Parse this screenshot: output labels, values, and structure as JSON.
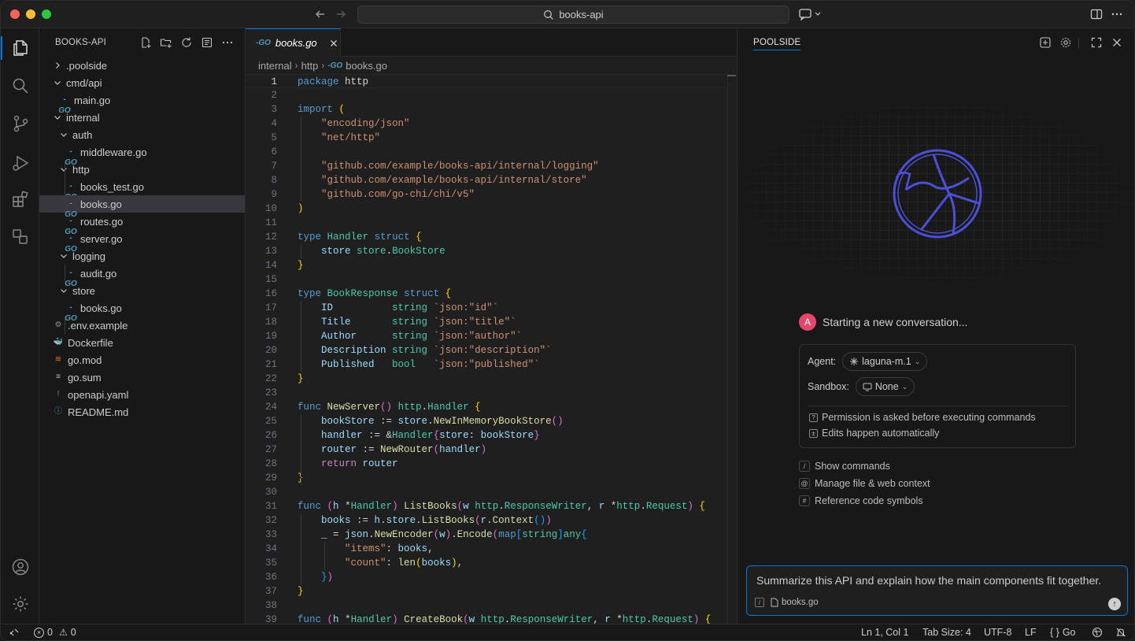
{
  "titlebar": {
    "search_text": "books-api"
  },
  "sidebar": {
    "title": "BOOKS-API",
    "tree": [
      {
        "label": ".poolside",
        "depth": 0,
        "kind": "folder-closed"
      },
      {
        "label": "cmd/api",
        "depth": 0,
        "kind": "folder-open"
      },
      {
        "label": "main.go",
        "depth": 1,
        "kind": "go"
      },
      {
        "label": "internal",
        "depth": 0,
        "kind": "folder-open"
      },
      {
        "label": "auth",
        "depth": 1,
        "kind": "folder-open"
      },
      {
        "label": "middleware.go",
        "depth": 2,
        "kind": "go"
      },
      {
        "label": "http",
        "depth": 1,
        "kind": "folder-open"
      },
      {
        "label": "books_test.go",
        "depth": 2,
        "kind": "go"
      },
      {
        "label": "books.go",
        "depth": 2,
        "kind": "go",
        "selected": true
      },
      {
        "label": "routes.go",
        "depth": 2,
        "kind": "go"
      },
      {
        "label": "server.go",
        "depth": 2,
        "kind": "go"
      },
      {
        "label": "logging",
        "depth": 1,
        "kind": "folder-open"
      },
      {
        "label": "audit.go",
        "depth": 2,
        "kind": "go"
      },
      {
        "label": "store",
        "depth": 1,
        "kind": "folder-open"
      },
      {
        "label": "books.go",
        "depth": 2,
        "kind": "go"
      },
      {
        "label": ".env.example",
        "depth": 0,
        "kind": "gear"
      },
      {
        "label": "Dockerfile",
        "depth": 0,
        "kind": "docker"
      },
      {
        "label": "go.mod",
        "depth": 0,
        "kind": "rss"
      },
      {
        "label": "go.sum",
        "depth": 0,
        "kind": "lines"
      },
      {
        "label": "openapi.yaml",
        "depth": 0,
        "kind": "yaml"
      },
      {
        "label": "README.md",
        "depth": 0,
        "kind": "info"
      }
    ]
  },
  "editor": {
    "tab_label": "books.go",
    "breadcrumb": [
      "internal",
      "http",
      "books.go"
    ],
    "current_line": 1,
    "lines": [
      [
        [
          "kw",
          "package"
        ],
        [
          "pl",
          " http"
        ]
      ],
      [],
      [
        [
          "kw",
          "import"
        ],
        [
          "pl",
          " "
        ],
        [
          "br",
          "("
        ]
      ],
      [
        [
          "pl",
          "    "
        ],
        [
          "str",
          "\"encoding/json\""
        ]
      ],
      [
        [
          "pl",
          "    "
        ],
        [
          "str",
          "\"net/http\""
        ]
      ],
      [],
      [
        [
          "pl",
          "    "
        ],
        [
          "str",
          "\"github.com/example/books-api/internal/logging\""
        ]
      ],
      [
        [
          "pl",
          "    "
        ],
        [
          "str",
          "\"github.com/example/books-api/internal/store\""
        ]
      ],
      [
        [
          "pl",
          "    "
        ],
        [
          "str",
          "\"github.com/go-chi/chi/v5\""
        ]
      ],
      [
        [
          "br",
          ")"
        ]
      ],
      [],
      [
        [
          "kw",
          "type"
        ],
        [
          "pl",
          " "
        ],
        [
          "ty",
          "Handler"
        ],
        [
          "pl",
          " "
        ],
        [
          "kw",
          "struct"
        ],
        [
          "pl",
          " "
        ],
        [
          "br",
          "{"
        ]
      ],
      [
        [
          "pl",
          "    "
        ],
        [
          "var",
          "store"
        ],
        [
          "pl",
          " "
        ],
        [
          "ty",
          "store"
        ],
        [
          "pl",
          "."
        ],
        [
          "ty",
          "BookStore"
        ]
      ],
      [
        [
          "br",
          "}"
        ]
      ],
      [],
      [
        [
          "kw",
          "type"
        ],
        [
          "pl",
          " "
        ],
        [
          "ty",
          "BookResponse"
        ],
        [
          "pl",
          " "
        ],
        [
          "kw",
          "struct"
        ],
        [
          "pl",
          " "
        ],
        [
          "br",
          "{"
        ]
      ],
      [
        [
          "pl",
          "    "
        ],
        [
          "var",
          "ID"
        ],
        [
          "pl",
          "          "
        ],
        [
          "ty",
          "string"
        ],
        [
          "pl",
          " "
        ],
        [
          "str",
          "`json:\"id\"`"
        ]
      ],
      [
        [
          "pl",
          "    "
        ],
        [
          "var",
          "Title"
        ],
        [
          "pl",
          "       "
        ],
        [
          "ty",
          "string"
        ],
        [
          "pl",
          " "
        ],
        [
          "str",
          "`json:\"title\"`"
        ]
      ],
      [
        [
          "pl",
          "    "
        ],
        [
          "var",
          "Author"
        ],
        [
          "pl",
          "      "
        ],
        [
          "ty",
          "string"
        ],
        [
          "pl",
          " "
        ],
        [
          "str",
          "`json:\"author\"`"
        ]
      ],
      [
        [
          "pl",
          "    "
        ],
        [
          "var",
          "Description"
        ],
        [
          "pl",
          " "
        ],
        [
          "ty",
          "string"
        ],
        [
          "pl",
          " "
        ],
        [
          "str",
          "`json:\"description\"`"
        ]
      ],
      [
        [
          "pl",
          "    "
        ],
        [
          "var",
          "Published"
        ],
        [
          "pl",
          "   "
        ],
        [
          "ty",
          "bool"
        ],
        [
          "pl",
          "   "
        ],
        [
          "str",
          "`json:\"published\"`"
        ]
      ],
      [
        [
          "br",
          "}"
        ]
      ],
      [],
      [
        [
          "kw",
          "func"
        ],
        [
          "pl",
          " "
        ],
        [
          "fn",
          "NewServer"
        ],
        [
          "br2",
          "()"
        ],
        [
          "pl",
          " "
        ],
        [
          "ty",
          "http"
        ],
        [
          "pl",
          "."
        ],
        [
          "ty",
          "Handler"
        ],
        [
          "pl",
          " "
        ],
        [
          "br",
          "{"
        ]
      ],
      [
        [
          "pl",
          "    "
        ],
        [
          "var",
          "bookStore"
        ],
        [
          "pl",
          " := "
        ],
        [
          "var",
          "store"
        ],
        [
          "pl",
          "."
        ],
        [
          "fn",
          "NewInMemoryBookStore"
        ],
        [
          "br2",
          "()"
        ]
      ],
      [
        [
          "pl",
          "    "
        ],
        [
          "var",
          "handler"
        ],
        [
          "pl",
          " := &"
        ],
        [
          "ty",
          "Handler"
        ],
        [
          "br2",
          "{"
        ],
        [
          "var",
          "store"
        ],
        [
          "pl",
          ": "
        ],
        [
          "var",
          "bookStore"
        ],
        [
          "br2",
          "}"
        ]
      ],
      [
        [
          "pl",
          "    "
        ],
        [
          "var",
          "router"
        ],
        [
          "pl",
          " := "
        ],
        [
          "fn",
          "NewRouter"
        ],
        [
          "br2",
          "("
        ],
        [
          "var",
          "handler"
        ],
        [
          "br2",
          ")"
        ]
      ],
      [
        [
          "pl",
          "    "
        ],
        [
          "kw2",
          "return"
        ],
        [
          "pl",
          " "
        ],
        [
          "var",
          "router"
        ]
      ],
      [
        [
          "br",
          "}"
        ]
      ],
      [],
      [
        [
          "kw",
          "func"
        ],
        [
          "pl",
          " "
        ],
        [
          "br2",
          "("
        ],
        [
          "var",
          "h"
        ],
        [
          "pl",
          " *"
        ],
        [
          "ty",
          "Handler"
        ],
        [
          "br2",
          ")"
        ],
        [
          "pl",
          " "
        ],
        [
          "fn",
          "ListBooks"
        ],
        [
          "br2",
          "("
        ],
        [
          "var",
          "w"
        ],
        [
          "pl",
          " "
        ],
        [
          "ty",
          "http"
        ],
        [
          "pl",
          "."
        ],
        [
          "ty",
          "ResponseWriter"
        ],
        [
          "pl",
          ", "
        ],
        [
          "var",
          "r"
        ],
        [
          "pl",
          " *"
        ],
        [
          "ty",
          "http"
        ],
        [
          "pl",
          "."
        ],
        [
          "ty",
          "Request"
        ],
        [
          "br2",
          ")"
        ],
        [
          "pl",
          " "
        ],
        [
          "br",
          "{"
        ]
      ],
      [
        [
          "pl",
          "    "
        ],
        [
          "var",
          "books"
        ],
        [
          "pl",
          " := "
        ],
        [
          "var",
          "h"
        ],
        [
          "pl",
          "."
        ],
        [
          "var",
          "store"
        ],
        [
          "pl",
          "."
        ],
        [
          "fn",
          "ListBooks"
        ],
        [
          "br2",
          "("
        ],
        [
          "var",
          "r"
        ],
        [
          "pl",
          "."
        ],
        [
          "fn",
          "Context"
        ],
        [
          "br3",
          "()"
        ],
        [
          "br2",
          ")"
        ]
      ],
      [
        [
          "pl",
          "    "
        ],
        [
          "var",
          "_"
        ],
        [
          "pl",
          " = "
        ],
        [
          "var",
          "json"
        ],
        [
          "pl",
          "."
        ],
        [
          "fn",
          "NewEncoder"
        ],
        [
          "br2",
          "("
        ],
        [
          "var",
          "w"
        ],
        [
          "br2",
          ")"
        ],
        [
          "pl",
          "."
        ],
        [
          "fn",
          "Encode"
        ],
        [
          "br2",
          "("
        ],
        [
          "kw",
          "map"
        ],
        [
          "br3",
          "["
        ],
        [
          "ty",
          "string"
        ],
        [
          "br3",
          "]"
        ],
        [
          "ty",
          "any"
        ],
        [
          "br3",
          "{"
        ]
      ],
      [
        [
          "pl",
          "        "
        ],
        [
          "str",
          "\"items\""
        ],
        [
          "pl",
          ": "
        ],
        [
          "var",
          "books"
        ],
        [
          "pl",
          ","
        ]
      ],
      [
        [
          "pl",
          "        "
        ],
        [
          "str",
          "\"count\""
        ],
        [
          "pl",
          ": "
        ],
        [
          "fn",
          "len"
        ],
        [
          "br",
          "("
        ],
        [
          "var",
          "books"
        ],
        [
          "br",
          ")"
        ],
        [
          "pl",
          ","
        ]
      ],
      [
        [
          "pl",
          "    "
        ],
        [
          "br3",
          "}"
        ],
        [
          "br2",
          ")"
        ]
      ],
      [
        [
          "br",
          "}"
        ]
      ],
      [],
      [
        [
          "kw",
          "func"
        ],
        [
          "pl",
          " "
        ],
        [
          "br2",
          "("
        ],
        [
          "var",
          "h"
        ],
        [
          "pl",
          " *"
        ],
        [
          "ty",
          "Handler"
        ],
        [
          "br2",
          ")"
        ],
        [
          "pl",
          " "
        ],
        [
          "fn",
          "CreateBook"
        ],
        [
          "br2",
          "("
        ],
        [
          "var",
          "w"
        ],
        [
          "pl",
          " "
        ],
        [
          "ty",
          "http"
        ],
        [
          "pl",
          "."
        ],
        [
          "ty",
          "ResponseWriter"
        ],
        [
          "pl",
          ", "
        ],
        [
          "var",
          "r"
        ],
        [
          "pl",
          " *"
        ],
        [
          "ty",
          "http"
        ],
        [
          "pl",
          "."
        ],
        [
          "ty",
          "Request"
        ],
        [
          "br2",
          ")"
        ],
        [
          "pl",
          " "
        ],
        [
          "br",
          "{"
        ]
      ]
    ]
  },
  "panel": {
    "title": "POOLSIDE",
    "avatar_letter": "A",
    "conversation_title": "Starting a new conversation...",
    "agent_label": "Agent:",
    "agent_value": "laguna-m.1",
    "sandbox_label": "Sandbox:",
    "sandbox_value": "None",
    "info_permission": "Permission is asked before executing commands",
    "info_edits": "Edits happen automatically",
    "hints": [
      {
        "key": "/",
        "label": "Show commands"
      },
      {
        "key": "@",
        "label": "Manage file & web context"
      },
      {
        "key": "#",
        "label": "Reference code symbols"
      }
    ],
    "input_text": "Summarize this API and explain how the main components fit together.",
    "input_context_file": "books.go"
  },
  "statusbar": {
    "errors": "0",
    "warnings": "0",
    "position": "Ln 1, Col 1",
    "tab_size": "Tab Size: 4",
    "encoding": "UTF-8",
    "eol": "LF",
    "language": "Go"
  },
  "colors": {
    "accent": "#0078d4",
    "avatar": "#e5466b",
    "logo": "#4b50d6"
  }
}
